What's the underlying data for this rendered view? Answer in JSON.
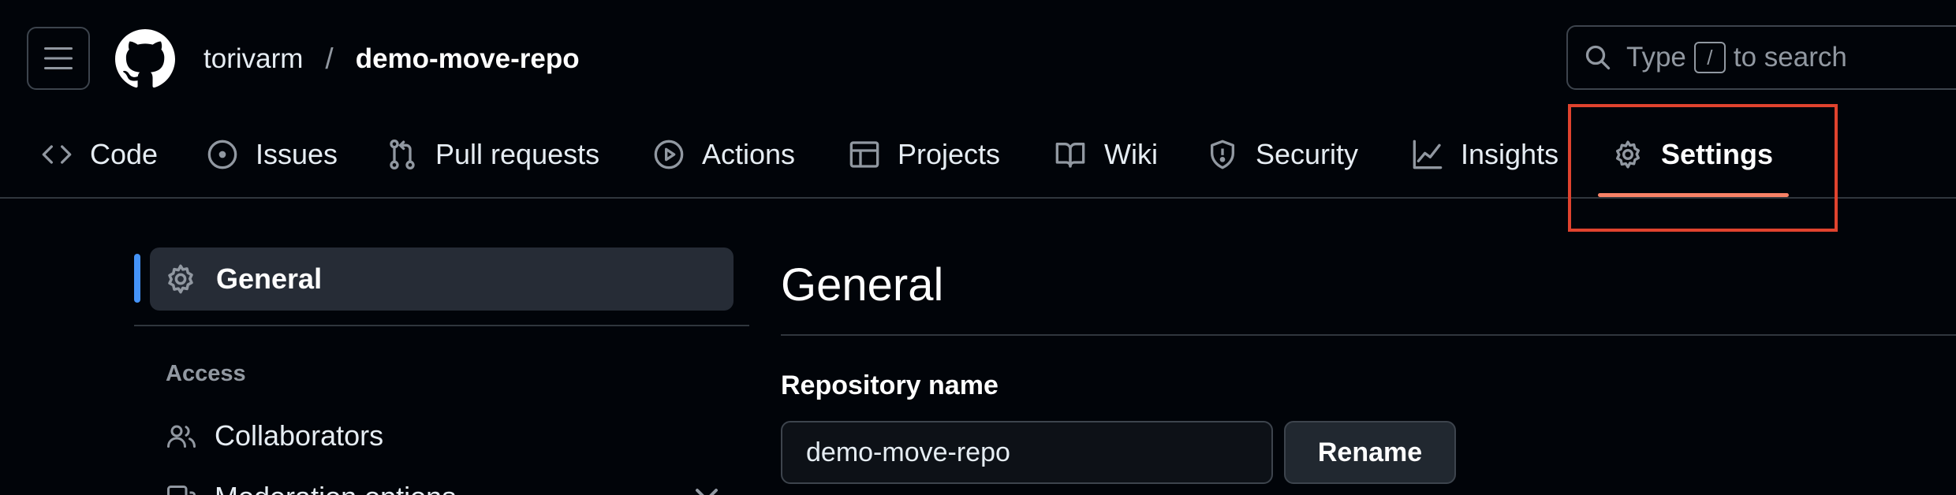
{
  "header": {
    "owner": "torivarm",
    "separator": "/",
    "repo": "demo-move-repo",
    "search": {
      "prefix": "Type",
      "key": "/",
      "suffix": "to search"
    }
  },
  "tabs": [
    {
      "label": "Code",
      "icon": "code-icon"
    },
    {
      "label": "Issues",
      "icon": "issue-opened-icon"
    },
    {
      "label": "Pull requests",
      "icon": "git-pull-request-icon"
    },
    {
      "label": "Actions",
      "icon": "play-icon"
    },
    {
      "label": "Projects",
      "icon": "table-icon"
    },
    {
      "label": "Wiki",
      "icon": "book-icon"
    },
    {
      "label": "Security",
      "icon": "shield-icon"
    },
    {
      "label": "Insights",
      "icon": "graph-icon"
    },
    {
      "label": "Settings",
      "icon": "gear-icon",
      "active": true
    }
  ],
  "sidebar": {
    "active_item": "General",
    "section_heading": "Access",
    "items": [
      {
        "label": "Collaborators",
        "icon": "people-icon"
      }
    ],
    "partial_item": {
      "label": "Moderation options",
      "icon": "comment-discussion-icon"
    }
  },
  "main": {
    "title": "General",
    "field_label": "Repository name",
    "repo_name_value": "demo-move-repo",
    "rename_label": "Rename"
  },
  "colors": {
    "background": "#010409",
    "active_underline": "#f78166",
    "highlight_box": "#e0432e",
    "sidebar_accent": "#4493f8"
  }
}
